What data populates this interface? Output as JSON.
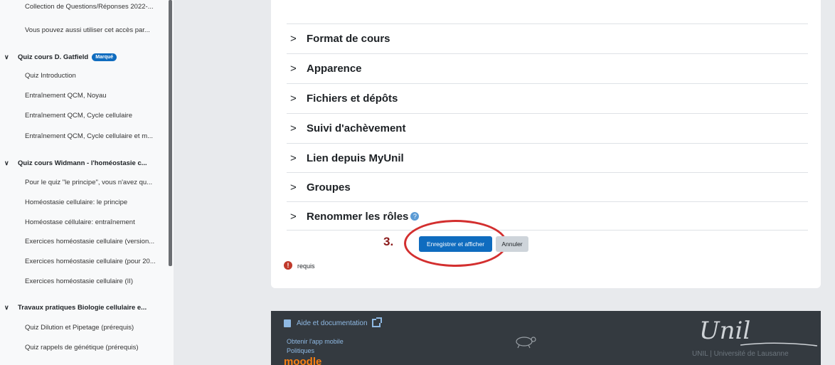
{
  "sidebar": {
    "items": [
      {
        "label": "Collection de Questions/Réponses 2022-..."
      },
      {
        "label": "Vous pouvez aussi utiliser cet accès par..."
      }
    ],
    "sections": [
      {
        "title": "Quiz cours D. Gatfield",
        "badge": "Marqué",
        "items": [
          "Quiz Introduction",
          "Entraînement QCM, Noyau",
          "Entraînement QCM, Cycle cellulaire",
          "Entraînement QCM, Cycle cellulaire et m..."
        ]
      },
      {
        "title": "Quiz cours Widmann - l'homéostasie c...",
        "items": [
          "Pour le quiz \"le principe\", vous n'avez qu...",
          "Homéostasie cellulaire: le principe",
          "Homéostase céllulaire: entraînement",
          "Exercices homéostasie cellulaire (version...",
          "Exercices homéostasie cellulaire (pour 20...",
          "Exercices homéostasie cellulaire (II)"
        ]
      },
      {
        "title": "Travaux pratiques Biologie cellulaire e...",
        "items": [
          "Quiz Dilution et Pipetage (prérequis)",
          "Quiz rappels de génétique (prérequis)"
        ]
      }
    ]
  },
  "main": {
    "sections": [
      {
        "label": "Format de cours"
      },
      {
        "label": "Apparence"
      },
      {
        "label": "Fichiers et dépôts"
      },
      {
        "label": "Suivi d'achèvement"
      },
      {
        "label": "Lien depuis MyUnil"
      },
      {
        "label": "Groupes"
      },
      {
        "label": "Renommer les rôles"
      }
    ],
    "save_button": "Enregistrer et afficher",
    "cancel_button": "Annuler",
    "annotation_number": "3.",
    "required_label": "requis"
  },
  "footer": {
    "help": "Aide et documentation",
    "mobile_app": "Obtenir l'app mobile",
    "policies": "Politiques",
    "moodle": "moodle",
    "unil_logo": "Unil",
    "unil_text": "UNIL | Université de Lausanne"
  },
  "colors": {
    "primary": "#0f6cbf",
    "annotation": "#d32f2f",
    "footer_bg": "#343a40"
  }
}
